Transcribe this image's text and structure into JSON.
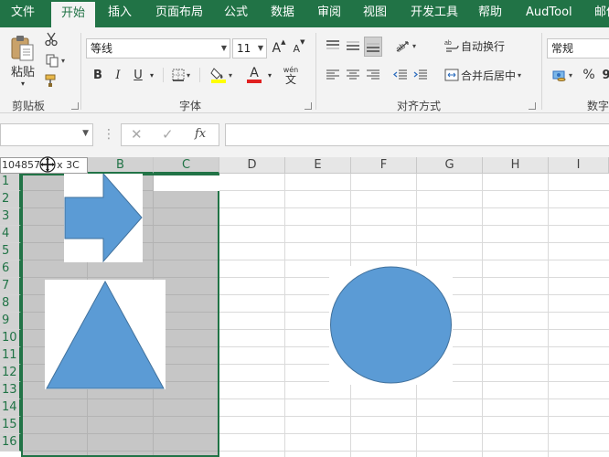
{
  "tabs": [
    {
      "label": "文件",
      "active": false
    },
    {
      "label": "开始",
      "active": true
    },
    {
      "label": "插入",
      "active": false
    },
    {
      "label": "页面布局",
      "active": false
    },
    {
      "label": "公式",
      "active": false
    },
    {
      "label": "数据",
      "active": false
    },
    {
      "label": "审阅",
      "active": false
    },
    {
      "label": "视图",
      "active": false
    },
    {
      "label": "开发工具",
      "active": false
    },
    {
      "label": "帮助",
      "active": false
    },
    {
      "label": "AudTool",
      "active": false
    },
    {
      "label": "邮件",
      "active": false
    }
  ],
  "clipboard": {
    "paste_label": "粘贴",
    "group_label": "剪贴板"
  },
  "font": {
    "family": "等线",
    "size": "11",
    "grow_label": "A",
    "shrink_label": "A",
    "bold": "B",
    "italic": "I",
    "underline": "U",
    "font_color_letter": "A",
    "fill_color": "#ffff00",
    "font_color": "#e02020",
    "phonetic_top": "wén",
    "phonetic_bottom": "文",
    "group_label": "字体"
  },
  "alignment": {
    "wrap_label": "自动换行",
    "merge_label": "合并后居中",
    "group_label": "对齐方式"
  },
  "number": {
    "format": "常规",
    "percent": "%",
    "comma": "9",
    "group_label": "数字"
  },
  "formula_bar": {
    "name_box_value": "",
    "cancel_symbol": "✕",
    "enter_symbol": "✓",
    "fx_label": "fx",
    "formula_value": ""
  },
  "grid": {
    "ref_preview": "1048576R x 3C",
    "columns": [
      "B",
      "C",
      "D",
      "E",
      "F",
      "G",
      "H",
      "I"
    ],
    "rows": [
      "1",
      "2",
      "3",
      "4",
      "5",
      "6",
      "7",
      "8",
      "9",
      "10",
      "11",
      "12",
      "13",
      "14",
      "15",
      "16"
    ],
    "selection_fill": "#c6c6c6",
    "accent": "#217346",
    "shape_fill": "#5b9bd5",
    "shape_stroke": "#41719c",
    "shapes": [
      "right-arrow",
      "triangle",
      "circle"
    ]
  }
}
